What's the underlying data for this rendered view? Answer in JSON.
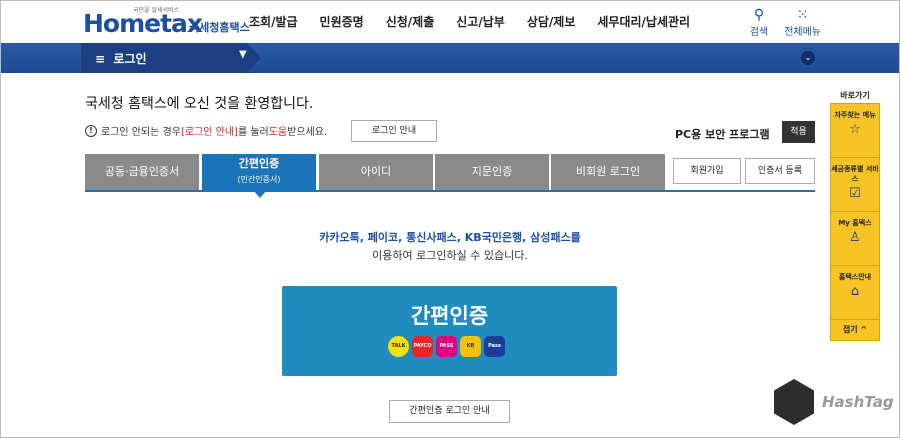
{
  "header": {
    "logo_text": "Hometax",
    "logo_tagline": "국민을 알세서비스",
    "logo_subtitle": "국세청홈택스",
    "nav": [
      "조회/발급",
      "민원증명",
      "신청/제출",
      "신고/납부",
      "상담/제보",
      "세무대리/납세관리"
    ],
    "search_label": "검색",
    "allmenu_label": "전체메뉴"
  },
  "menubar": {
    "label": "로그인"
  },
  "main": {
    "welcome": "국세청 홈택스에 오신 것을 환영합니다.",
    "notice_before": "로그인 안되는 경우 ",
    "notice_link": "[로그인 안내]",
    "notice_mid": "를 눌러 ",
    "notice_help": "도움",
    "notice_after": "받으세요.",
    "guide_button": "로그인 안내",
    "pc_security_label": "PC용 보안 프로그램",
    "apply_button": "적용"
  },
  "tabs": [
    {
      "label": "공동·금융인증서",
      "sub": ""
    },
    {
      "label": "간편인증",
      "sub": "(민간인증서)"
    },
    {
      "label": "아이디",
      "sub": ""
    },
    {
      "label": "지문인증",
      "sub": ""
    },
    {
      "label": "비회원 로그인",
      "sub": ""
    }
  ],
  "side_buttons": {
    "join": "회원가입",
    "register_cert": "인증서 등록"
  },
  "simple_auth": {
    "providers_line": "카카오톡, 페이코, 통신사패스, KB국민은행, 삼성패스를",
    "usage_line": "이용하여 로그인하실 수 있습니다.",
    "box_title": "간편인증",
    "providers": [
      {
        "name": "TALK",
        "bg": "#f9e000",
        "fg": "#3a1d1d"
      },
      {
        "name": "PAYCO",
        "bg": "#e8262a",
        "fg": "#ffffff"
      },
      {
        "name": "PASS",
        "bg": "#e3007f",
        "fg": "#ffffff"
      },
      {
        "name": "KB",
        "bg": "#f2c400",
        "fg": "#333333"
      },
      {
        "name": "Pass",
        "bg": "#1a3e9a",
        "fg": "#ffffff"
      }
    ],
    "guide_button": "간편인증 로그인 안내"
  },
  "quick_panel": {
    "title": "바로가기",
    "items": [
      {
        "label": "자주찾는 메뉴",
        "icon": "star-icon",
        "glyph": "☆"
      },
      {
        "label": "세금종류별 서비스",
        "icon": "checkbox-icon",
        "glyph": "☑"
      },
      {
        "label": "My 홈택스",
        "icon": "person-icon",
        "glyph": "👤"
      },
      {
        "label": "홈택스안내",
        "icon": "home-icon",
        "glyph": "⌂"
      }
    ],
    "close_label": "접기 ^"
  },
  "watermark": {
    "text": "HashTag",
    "cube_text": "HashTag"
  },
  "colors": {
    "brand_blue": "#1d4fa3",
    "tab_active": "#1c74b8",
    "box_blue": "#1f8bbf",
    "quick_yellow": "#f7c325"
  }
}
